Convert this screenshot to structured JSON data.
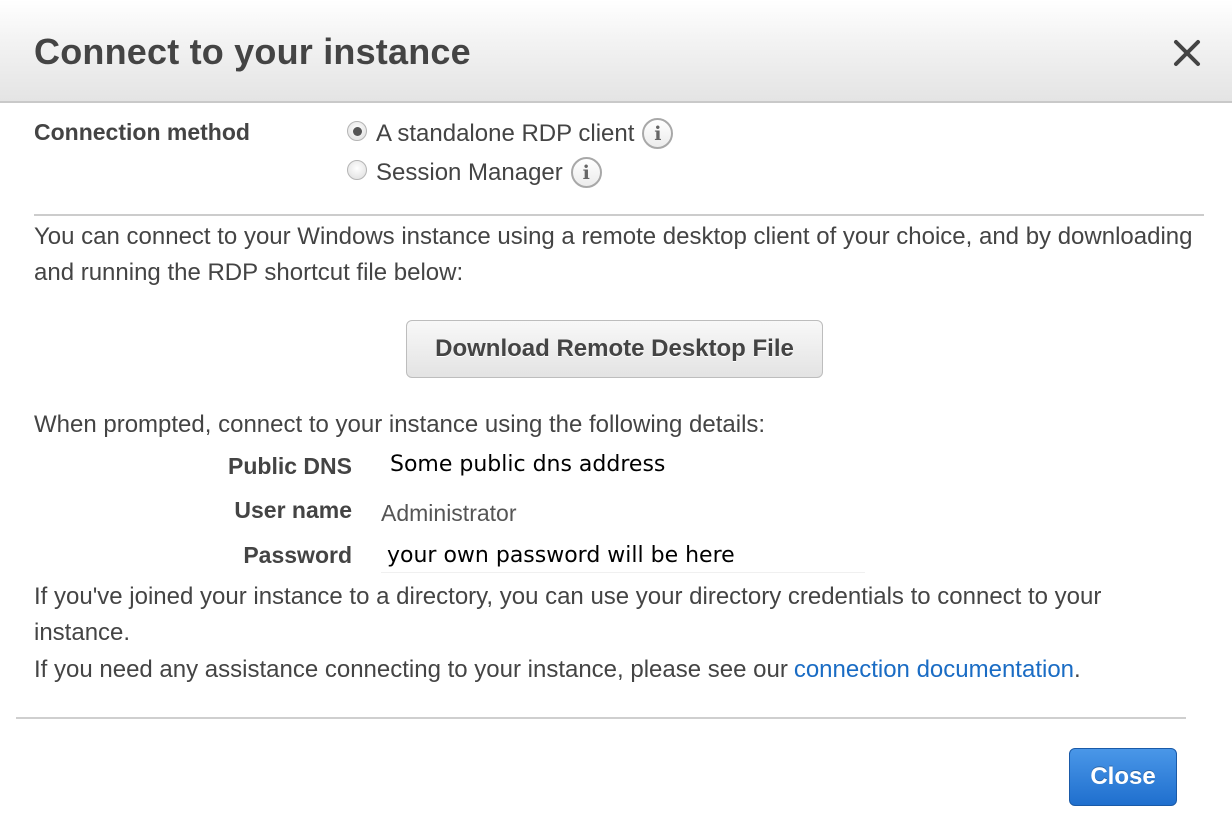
{
  "dialog": {
    "title": "Connect to your instance",
    "close_icon": "close-icon"
  },
  "connection_method": {
    "label": "Connection method",
    "options": [
      {
        "label": "A standalone RDP client",
        "selected": true,
        "icon": "info-icon",
        "icon_glyph": "i"
      },
      {
        "label": "Session Manager",
        "selected": false,
        "icon": "info-icon",
        "icon_glyph": "i"
      }
    ]
  },
  "intro_text": "You can connect to your Windows instance using a remote desktop client of your choice, and by downloading and running the RDP shortcut file below:",
  "download_button": {
    "label": "Download Remote Desktop File"
  },
  "prompt_text": "When prompted, connect to your instance using the following details:",
  "details": [
    {
      "label": "Public DNS",
      "value": "Some public dns address"
    },
    {
      "label": "User name",
      "value": "Administrator"
    },
    {
      "label": "Password",
      "value": "your own password will be here"
    }
  ],
  "directory_text": "If you've joined your instance to a directory, you can use your directory credentials to connect to your instance.",
  "assistance": {
    "text": "If you need any assistance connecting to your instance, please see our",
    "link_label": "connection documentation",
    "suffix": "."
  },
  "footer": {
    "close_label": "Close"
  },
  "colors": {
    "primary_button": "#2b7bd8",
    "link": "#1a6cc4",
    "text": "#444444"
  }
}
